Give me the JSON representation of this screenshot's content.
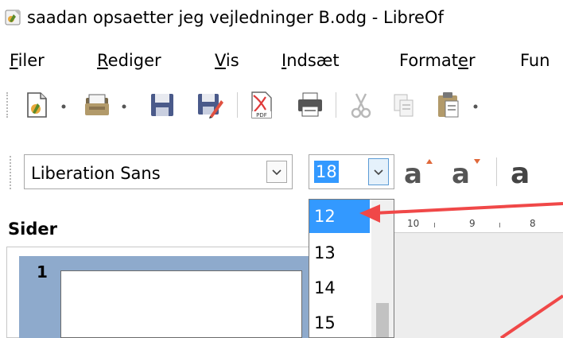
{
  "window": {
    "title": "saadan opsaetter jeg vejledninger B.odg - LibreOf",
    "app_icon": "libreoffice-draw-icon"
  },
  "menubar": {
    "items": [
      {
        "label": "Filer",
        "access_key_index": 0
      },
      {
        "label": "Rediger",
        "access_key_index": 0
      },
      {
        "label": "Vis",
        "access_key_index": 0
      },
      {
        "label": "Indsæt",
        "access_key_index": 0
      },
      {
        "label": "Formater",
        "access_key_index": 6
      },
      {
        "label": "Fun",
        "access_key_index": -1
      }
    ]
  },
  "toolbar": {
    "icons": [
      "new-document-icon",
      "open-folder-icon",
      "save-icon",
      "save-as-icon",
      "export-pdf-icon",
      "print-icon",
      "cut-icon",
      "copy-icon",
      "paste-icon"
    ],
    "pdf_label": "PDF"
  },
  "format_toolbar": {
    "font_name": "Liberation Sans",
    "font_size": "18",
    "grow_icon": "grow-font-icon",
    "shrink_icon": "shrink-font-icon",
    "fontwork_icon": "fontwork-icon"
  },
  "font_size_dropdown": {
    "options": [
      "12",
      "13",
      "14",
      "15"
    ],
    "selected": "12"
  },
  "sidebar": {
    "title": "Sider",
    "slides": [
      {
        "number": "1"
      }
    ]
  },
  "ruler": {
    "labels": [
      "10",
      "9",
      "8"
    ]
  },
  "colors": {
    "selection": "#3399ff",
    "slide_selected_bg": "#8eaacc",
    "annotation_arrow": "#f04848"
  }
}
